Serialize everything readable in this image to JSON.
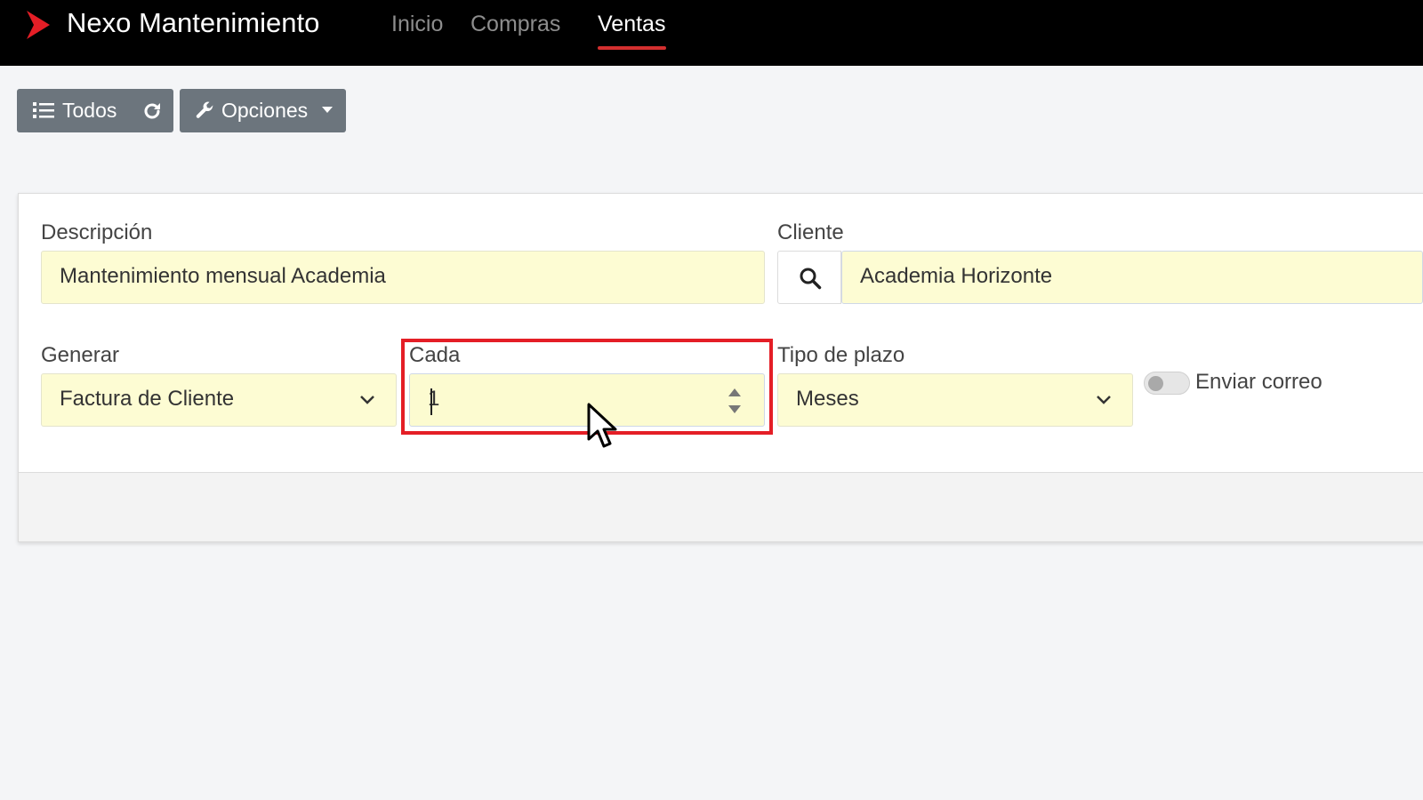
{
  "app": {
    "name": "Nexo Mantenimiento",
    "brand_color": "#e41e26"
  },
  "nav": {
    "items": [
      {
        "label": "Inicio",
        "active": false
      },
      {
        "label": "Compras",
        "active": false
      },
      {
        "label": "Ventas",
        "active": true
      }
    ]
  },
  "toolbar": {
    "all_label": "Todos",
    "all_icon": "list-icon",
    "refresh_icon": "refresh-icon",
    "options_label": "Opciones",
    "options_icon": "wrench-icon"
  },
  "form": {
    "description": {
      "label": "Descripción",
      "value": "Mantenimiento mensual Academia"
    },
    "client": {
      "label": "Cliente",
      "value": "Academia Horizonte",
      "icon": "search-icon"
    },
    "generate": {
      "label": "Generar",
      "value": "Factura de Cliente"
    },
    "every": {
      "label": "Cada",
      "value": "1"
    },
    "term_type": {
      "label": "Tipo de plazo",
      "value": "Meses"
    },
    "send_email": {
      "label": "Enviar correo",
      "enabled": false
    }
  },
  "colors": {
    "navbar_bg": "#000000",
    "active_underline": "#d32f2f",
    "button_bg": "#6c757d",
    "field_bg": "#fdfcd3",
    "highlight_border": "#e41e26"
  }
}
